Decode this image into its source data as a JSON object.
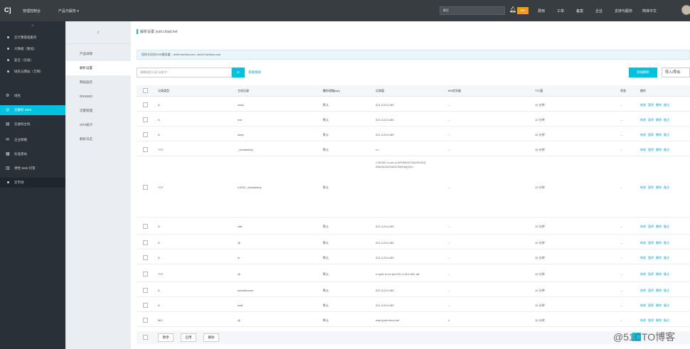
{
  "topbar": {
    "logo": "C]",
    "console": "管理控制台",
    "products": "产品与服务 ▾",
    "search_placeholder": "搜索",
    "badge": "99+",
    "nav": [
      "费用",
      "工单",
      "备案",
      "企业",
      "支持与服务",
      "简体中文"
    ]
  },
  "sidebar": {
    "collapse": "≡",
    "items": [
      {
        "label": "云计算基础服务",
        "type": "dot"
      },
      {
        "label": "大数据（数加）",
        "type": "dot"
      },
      {
        "label": "安全（云盾）",
        "type": "dot"
      },
      {
        "label": "域名与网站（万网）",
        "type": "dot"
      },
      {
        "label": "域名",
        "type": "icon",
        "icon": "⚙"
      },
      {
        "label": "云解析 DNS",
        "type": "icon",
        "icon": "◎",
        "active": true
      },
      {
        "label": "云虚拟主机",
        "type": "icon",
        "icon": "▤"
      },
      {
        "label": "企业邮箱",
        "type": "icon",
        "icon": "✉"
      },
      {
        "label": "标准建站",
        "type": "icon",
        "icon": "▦"
      },
      {
        "label": "弹性 Web 托管",
        "type": "icon",
        "icon": "▥"
      },
      {
        "label": "云市场",
        "type": "dot",
        "sub": true
      }
    ]
  },
  "subnav": {
    "back": "‹",
    "items": [
      {
        "label": "产品详情"
      },
      {
        "label": "解析设置",
        "active": true
      },
      {
        "label": "网站监控"
      },
      {
        "label": "DNSSEC"
      },
      {
        "label": "流量管理"
      },
      {
        "label": "GPS统计"
      },
      {
        "label": "解析日志"
      }
    ]
  },
  "main": {
    "breadcrumb": "解析设置 yunt.cloud.net",
    "notice": "您的主机名DNS服务器：dns9.hichina.com, dns10.hichina.com",
    "search_placeholder": "模糊搜索记录 向量字？",
    "adv_search": "高级搜索",
    "add_button": "添加解析",
    "import_button": "导入/导出",
    "columns": [
      "记录类型",
      "主机记录",
      "解析线路(isp)",
      "记录值",
      "MX优先级",
      "TTL值",
      "状态",
      "操作"
    ],
    "rows": [
      {
        "type": "A",
        "host": "www",
        "line": "默认",
        "value": "221.4.214.180",
        "mx": "--",
        "ttl": "10 分钟",
        "status": "--"
      },
      {
        "type": "A",
        "host": "exe",
        "line": "默认",
        "value": "221.4.214.180",
        "mx": "--",
        "ttl": "10 分钟",
        "status": "--"
      },
      {
        "type": "A",
        "host": "smtp",
        "line": "默认",
        "value": "221.4.214.180",
        "mx": "--",
        "ttl": "10 分钟",
        "status": "--"
      },
      {
        "type": "TXT",
        "host": "_domainkey",
        "line": "默认",
        "value": "v=..",
        "mx": "--",
        "ttl": "10 分钟",
        "status": "--"
      },
      {
        "type": "TXT",
        "host": "s1024._domainkey",
        "line": "默认",
        "value": "v=DKIM1; k=rsa; p=MIGfMA0GCSqGSIb3DQEBAQUAA4GNADCBiQKBgQCfe...",
        "mx": "--",
        "ttl": "10 分钟",
        "status": "--"
      },
      {
        "type": "A",
        "host": "stat",
        "line": "默认",
        "value": "221.4.214.180",
        "mx": "--",
        "ttl": "10 分钟",
        "status": "--"
      },
      {
        "type": "A",
        "host": "@",
        "line": "默认",
        "value": "221.4.214.180",
        "mx": "--",
        "ttl": "10 分钟",
        "status": "--"
      },
      {
        "type": "A",
        "host": "m",
        "line": "默认",
        "value": "221.4.214.180",
        "mx": "--",
        "ttl": "10 分钟",
        "status": "--"
      },
      {
        "type": "TXT",
        "host": "@",
        "line": "默认",
        "value": "v=spf1 a mx ip4:221.4.214.180 -all",
        "mx": "--",
        "ttl": "10 分钟",
        "status": "--"
      },
      {
        "type": "A",
        "host": "autodiscover",
        "line": "默认",
        "value": "221.4.214.180",
        "mx": "--",
        "ttl": "10 分钟",
        "status": "--"
      },
      {
        "type": "A",
        "host": "mail",
        "line": "默认",
        "value": "221.4.214.180",
        "mx": "--",
        "ttl": "10 分钟",
        "status": "--"
      },
      {
        "type": "MX",
        "host": "@",
        "line": "默认",
        "value": "mail.yunt.cloud.net",
        "mx": "1",
        "ttl": "10 分钟",
        "status": "--"
      }
    ],
    "ops": [
      "修改",
      "暂停",
      "删除",
      "备注"
    ],
    "footer_buttons": [
      "暂停",
      "启用",
      "删除"
    ],
    "watermark": "@51CTO博客"
  }
}
